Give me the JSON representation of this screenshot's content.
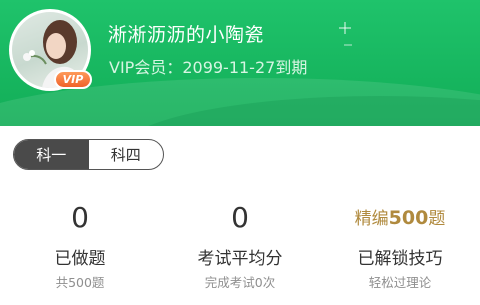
{
  "profile": {
    "username": "淅淅沥沥的小陶瓷",
    "vip_label": "VIP会员：",
    "vip_expiry": "2099-11-27到期",
    "vip_badge": "VIP"
  },
  "subject_tabs": [
    {
      "label": "科一",
      "active": true
    },
    {
      "label": "科四",
      "active": false
    }
  ],
  "stats": {
    "done": {
      "value": "0",
      "label": "已做题",
      "sub": "共500题"
    },
    "average": {
      "value": "0",
      "label": "考试平均分",
      "sub": "完成考试0次"
    },
    "tips": {
      "promo_prefix": "精编",
      "promo_number": "500",
      "promo_suffix": "题",
      "label": "已解锁技巧",
      "sub": "轻松过理论"
    }
  },
  "colors": {
    "header_green": "#1ab863",
    "segment_active": "#4a4a4a",
    "promo_gold": "#b08a3e"
  }
}
